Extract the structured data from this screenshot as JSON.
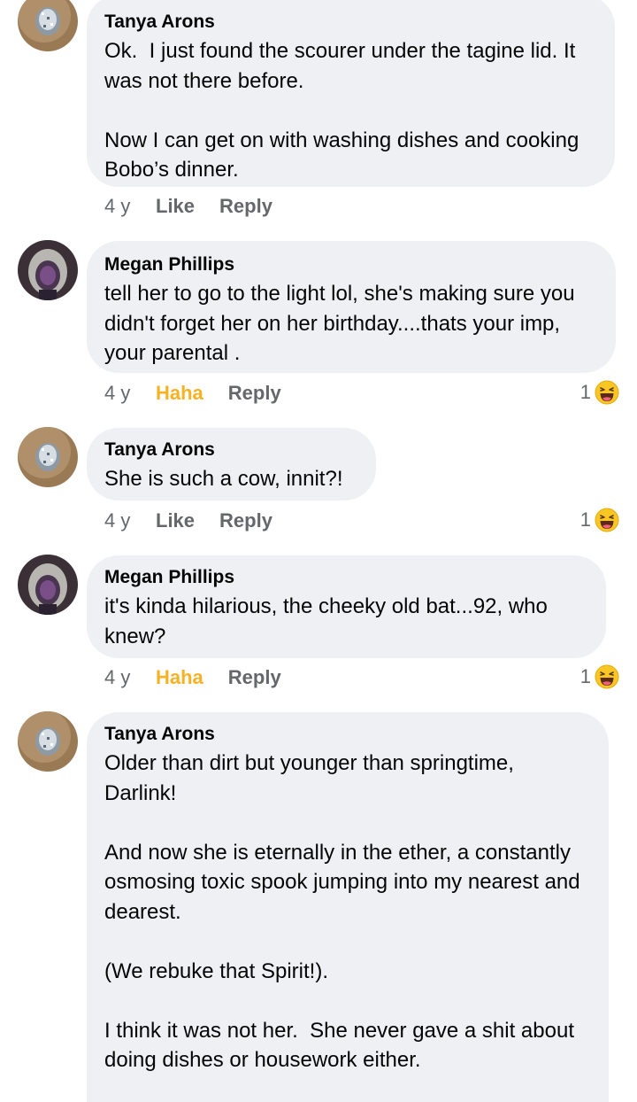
{
  "comments": [
    {
      "author": "Tanya Arons",
      "avatar": "disco-ball-avatar",
      "text": "Ok.  I just found the scourer under the tagine lid. It was not there before.\n\nNow I can get on with washing dishes and cooking Bobo’s dinner.",
      "time": "4 y",
      "like_label": "Like",
      "reply_label": "Reply",
      "reaction_count": ""
    },
    {
      "author": "Megan Phillips",
      "avatar": "hooded-person-avatar",
      "text": "tell her to go to the light lol, she's making sure you didn't forget her on her birthday....thats your imp, your parental .",
      "time": "4 y",
      "like_label": "Haha",
      "reply_label": "Reply",
      "reaction_count": "1",
      "reaction_icon": "haha-emoji-icon"
    },
    {
      "author": "Tanya Arons",
      "avatar": "disco-ball-avatar",
      "text": "She is such a cow, innit?!",
      "time": "4 y",
      "like_label": "Like",
      "reply_label": "Reply",
      "reaction_count": "1",
      "reaction_icon": "haha-emoji-icon"
    },
    {
      "author": "Megan Phillips",
      "avatar": "hooded-person-avatar",
      "text": "it's kinda hilarious, the cheeky old bat...92, who knew?",
      "time": "4 y",
      "like_label": "Haha",
      "reply_label": "Reply",
      "reaction_count": "1",
      "reaction_icon": "haha-emoji-icon"
    },
    {
      "author": "Tanya Arons",
      "avatar": "disco-ball-avatar",
      "text": "Older than dirt but younger than springtime, Darlink!\n\nAnd now she is eternally in the ether, a constantly osmosing toxic spook jumping into my nearest and dearest.\n\n(We rebuke that Spirit!).\n\nI think it was not her.  She never gave a shit about doing dishes or housework either."
    }
  ],
  "colors": {
    "bubble": "#eff0f4",
    "secondary_text": "#65676b",
    "haha_accent": "#f7b125"
  }
}
